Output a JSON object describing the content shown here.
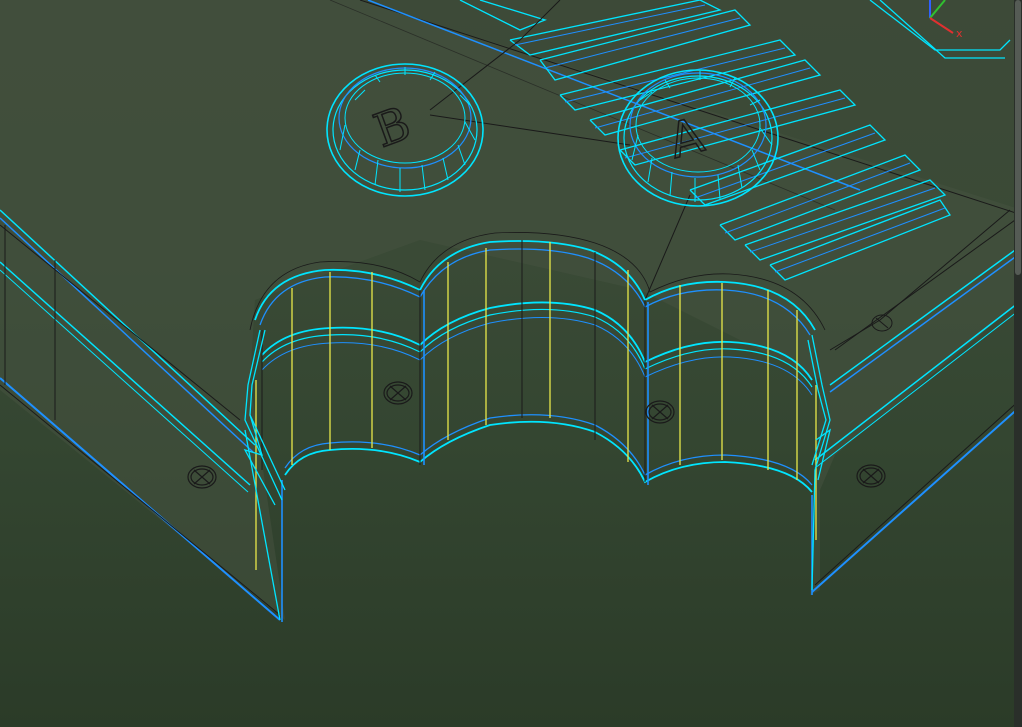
{
  "viewport": {
    "kind": "3D CAD wireframe viewport",
    "colors": {
      "background_top": "#3d4a38",
      "background_bottom": "#2b3b28",
      "face_fill": "#45523f",
      "edge_black": "#1a1a1a",
      "edge_selected": "#00e5ff",
      "edge_blue": "#1e90ff",
      "edge_yellow": "#e8e84a"
    }
  },
  "labels": {
    "button_a": "A",
    "button_b": "B"
  },
  "axis_gizmo": {
    "x_label": "x",
    "x_color": "#e03030",
    "y_color": "#30c030",
    "z_color": "#3060ff"
  }
}
